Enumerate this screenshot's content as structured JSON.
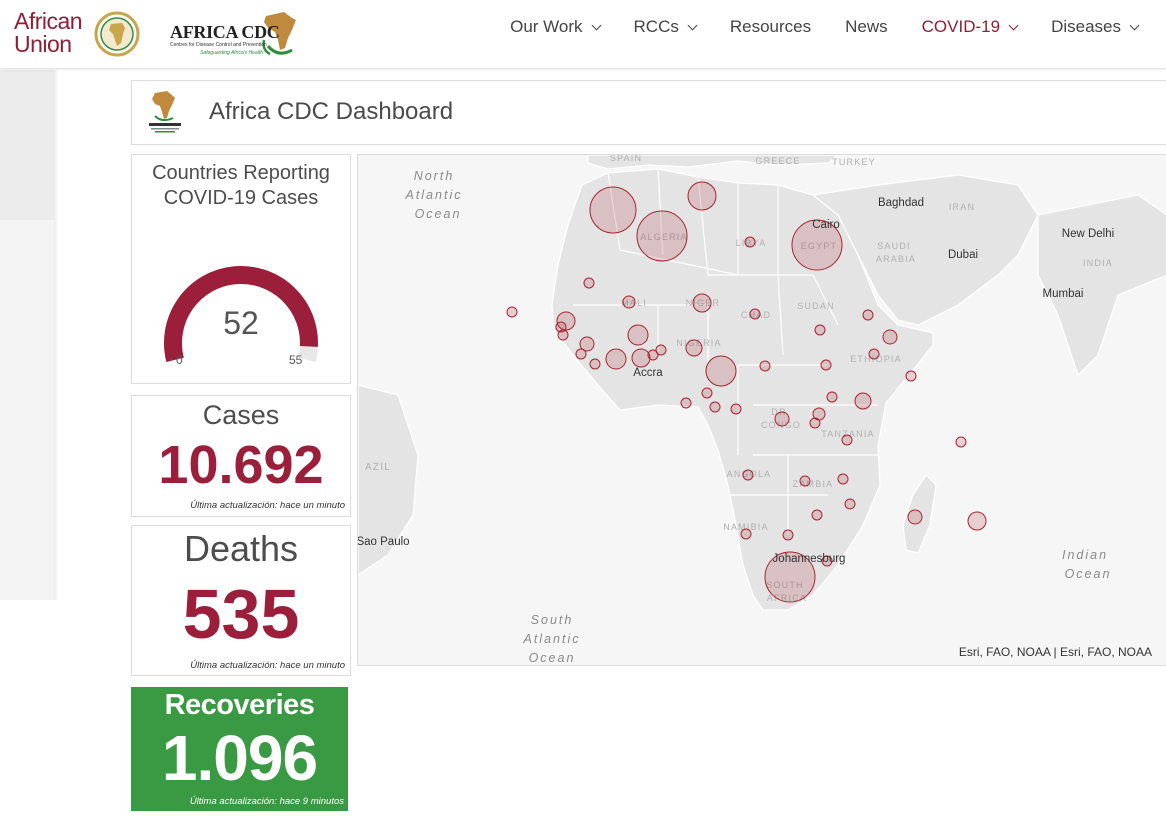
{
  "header": {
    "au_logo_line1": "African",
    "au_logo_line2": "Union",
    "cdc_logo_title": "AFRICA CDC",
    "cdc_logo_subtitle": "Centres for Disease Control and Prevention",
    "cdc_logo_tagline": "Safeguarding Africa's Health",
    "nav": [
      {
        "label": "Our Work",
        "dropdown": true,
        "active": false
      },
      {
        "label": "RCCs",
        "dropdown": true,
        "active": false
      },
      {
        "label": "Resources",
        "dropdown": false,
        "active": false
      },
      {
        "label": "News",
        "dropdown": false,
        "active": false
      },
      {
        "label": "COVID-19",
        "dropdown": true,
        "active": true
      },
      {
        "label": "Diseases",
        "dropdown": true,
        "active": false
      }
    ],
    "colors": {
      "brand": "#8d1f37",
      "nav_text": "#444444"
    }
  },
  "dashboard": {
    "title": "Africa CDC Dashboard",
    "gauge": {
      "title": "Countries Reporting COVID-19 Cases",
      "value": "52",
      "min": "0",
      "max": "55",
      "fraction": 0.945,
      "color": "#9b1f3b"
    },
    "cases": {
      "label": "Cases",
      "value": "10.692",
      "note": "Última actualización: hace un minuto"
    },
    "deaths": {
      "label": "Deaths",
      "value": "535",
      "note": "Última actualización: hace un minuto"
    },
    "recoveries": {
      "label": "Recoveries",
      "value": "1.096",
      "note": "Última actualización: hace 9 minutos",
      "color": "#3a9a43"
    }
  },
  "map": {
    "labels": {
      "ocean_north_atlantic": [
        "North",
        "Atlantic",
        "Ocean"
      ],
      "ocean_south_atlantic": [
        "South",
        "Atlantic",
        "Ocean"
      ],
      "ocean_indian": [
        "Indian",
        "Ocean"
      ],
      "spain": "SPAIN",
      "greece": "GREECE",
      "turkey": "TURKEY",
      "baghdad": "Baghdad",
      "iran": "IRAN",
      "cairo": "Cairo",
      "new_delhi": "New Delhi",
      "algeria": "ALGERIA",
      "libya": "LIBYA",
      "egypt": "EGYPT",
      "saudi_arabia": [
        "SAUDI",
        "ARABIA"
      ],
      "dubai": "Dubai",
      "india": "INDIA",
      "mumbai": "Mumbai",
      "mali": "MALI",
      "niger": "NIGER",
      "chad": "CHAD",
      "sudan": "SUDAN",
      "nigeria": "NIGERIA",
      "ethiopia": "ETHIOPIA",
      "accra": "Accra",
      "dr_congo": [
        "DR",
        "CONGO"
      ],
      "tanzania": "TANZANIA",
      "brazil": "AZIL",
      "angola": "ANGOLA",
      "zambia": "ZAMBIA",
      "namibia": "NAMIBIA",
      "sao_paulo": "Sao Paulo",
      "johannesburg": "Johannesburg",
      "south_africa": [
        "SOUTH",
        "AFRICA"
      ]
    },
    "attribution": "Esri, FAO, NOAA | Esri, FAO, NOAA",
    "bubble_color": "#a8232f"
  }
}
